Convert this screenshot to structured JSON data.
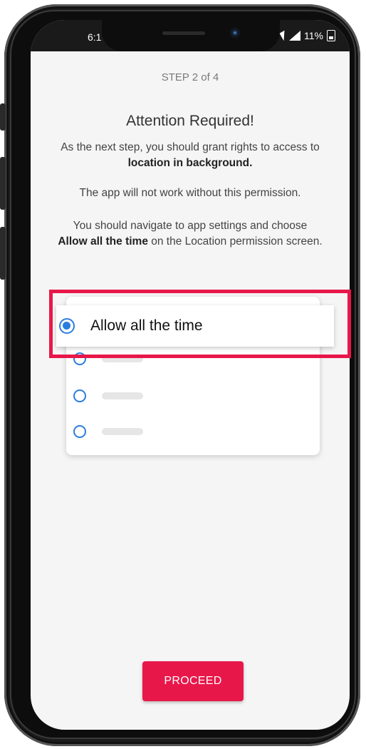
{
  "status_bar": {
    "time": "6:1",
    "battery_percent": "11%"
  },
  "step_label": "STEP 2 of 4",
  "title": "Attention Required!",
  "paragraph1": {
    "text": "As the next step, you should grant rights to access to ",
    "bold": "location in background."
  },
  "paragraph2": "The app will not work without this permission.",
  "paragraph3": {
    "prefix": "You should navigate to app settings and choose",
    "bold": "Allow all the time",
    "suffix": " on the Location permission screen."
  },
  "selected_option": "Allow all the time",
  "proceed_button": "PROCEED",
  "colors": {
    "accent": "#e8174a",
    "radio": "#2a7de1"
  }
}
